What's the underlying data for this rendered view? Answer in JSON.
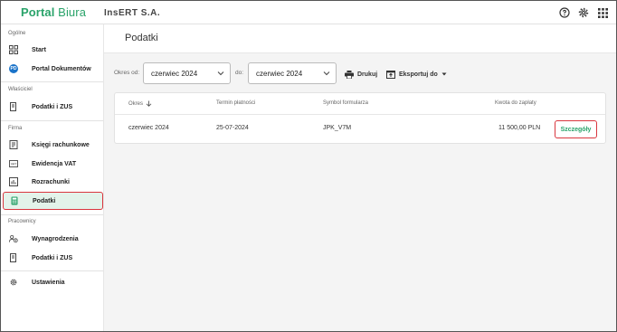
{
  "header": {
    "brand_part1": "Portal",
    "brand_part2": "Biura",
    "company": "InsERT S.A.",
    "icons": [
      "help-icon",
      "gear-icon",
      "apps-grid-icon"
    ]
  },
  "sidebar": {
    "sections": {
      "general": "Ogólne",
      "owner": "Właściciel",
      "firm": "Firma",
      "employees": "Pracownicy"
    },
    "items": {
      "start": "Start",
      "portal_docs": "Portal Dokumentów",
      "portal_docs_badge": "PD",
      "owner_taxes": "Podatki i ZUS",
      "ledger": "Księgi rachunkowe",
      "vat": "Ewidencja VAT",
      "settlements": "Rozrachunki",
      "taxes": "Podatki",
      "salaries": "Wynagrodzenia",
      "emp_taxes": "Podatki i ZUS",
      "settings": "Ustawienia"
    }
  },
  "main": {
    "title": "Podatki",
    "filters": {
      "from_label": "Okres od:",
      "from_value": "czerwiec 2024",
      "to_label": "do:",
      "to_value": "czerwiec 2024",
      "print_label": "Drukuj",
      "export_label": "Eksportuj do"
    },
    "table": {
      "columns": [
        "Okres",
        "Termin płatności",
        "Symbol formularza",
        "Kwota do zapłaty"
      ],
      "rows": [
        {
          "period": "czerwiec 2024",
          "due": "25-07-2024",
          "symbol": "JPK_V7M",
          "amount": "11 500,00 PLN",
          "action": "Szczegóły"
        }
      ]
    }
  },
  "colors": {
    "brand_green": "#2aa36a",
    "active_bg": "#e3f3ea",
    "highlight_red": "#d9363e",
    "badge_blue": "#1a73c9"
  }
}
